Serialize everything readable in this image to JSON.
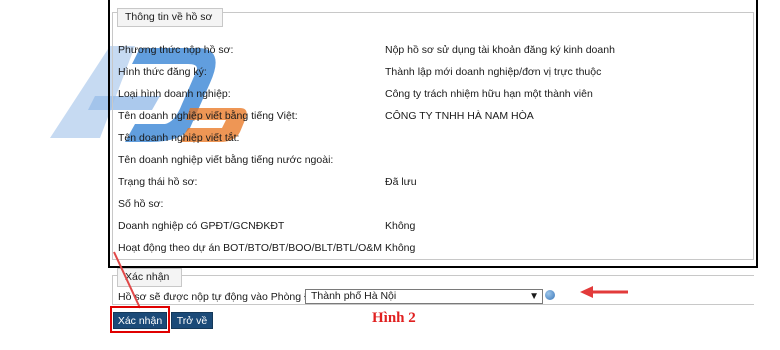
{
  "form": {
    "section_title": "Thông tin về hồ sơ",
    "rows": [
      {
        "label": "Phương thức nộp hồ sơ:",
        "value": "Nộp hồ sơ sử dụng tài khoản đăng ký kinh doanh"
      },
      {
        "label": "Hình thức đăng ký:",
        "value": "Thành lập mới doanh nghiệp/đơn vị trực thuộc"
      },
      {
        "label": "Loại hình doanh nghiệp:",
        "value": "Công ty trách nhiệm hữu hạn một thành viên"
      },
      {
        "label": "Tên doanh nghiệp viết bằng tiếng Việt:",
        "value": "CÔNG TY TNHH HÀ NAM HÒA"
      },
      {
        "label": "Tên doanh nghiệp viết tắt:",
        "value": ""
      },
      {
        "label": "Tên doanh nghiệp viết bằng tiếng nước ngoài:",
        "value": ""
      },
      {
        "label": "Trạng thái hồ sơ:",
        "value": "Đã lưu"
      },
      {
        "label": "Số hồ sơ:",
        "value": ""
      },
      {
        "label": "Doanh nghiệp có GPĐT/GCNĐKĐT",
        "value": "Không"
      },
      {
        "label": "Hoạt động theo dự án BOT/BTO/BT/BOO/BLT/BTL/O&M",
        "value": "Không"
      }
    ]
  },
  "confirm": {
    "section_title": "Xác nhận",
    "office_label": "Hồ sơ sẽ được nộp tự động vào Phòng ĐKKD*:",
    "office_selected": "Thành phố Hà Nội",
    "help_icon": "info-icon"
  },
  "buttons": {
    "confirm": "Xác nhận",
    "back": "Trở về"
  },
  "caption": "Hình 2",
  "colors": {
    "button_bg": "#1b4a78",
    "highlight": "#e00000",
    "caption": "#e02020",
    "logo": "#3a86d6"
  }
}
